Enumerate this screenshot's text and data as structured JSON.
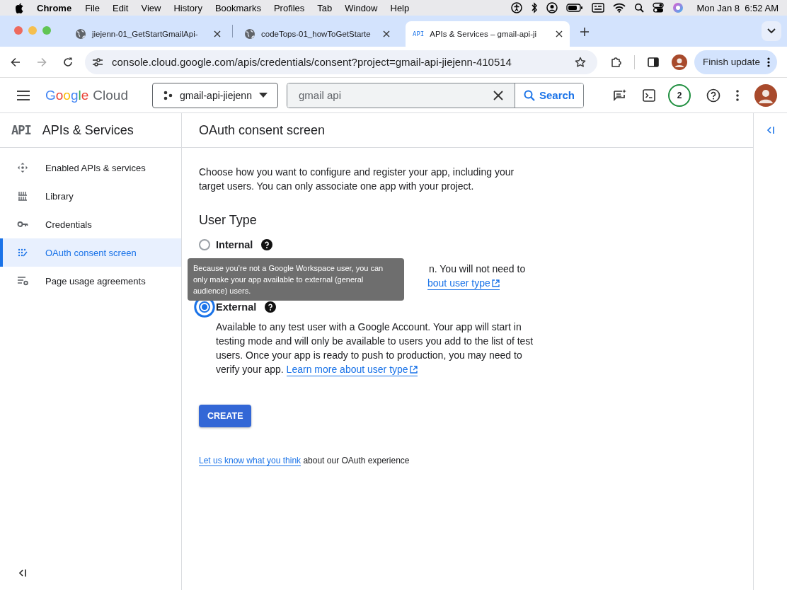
{
  "menu_bar": {
    "app": "Chrome",
    "items": [
      "File",
      "Edit",
      "View",
      "History",
      "Bookmarks",
      "Profiles",
      "Tab",
      "Window",
      "Help"
    ],
    "clock": "Mon Jan 8  6:52 AM"
  },
  "browser": {
    "tabs": [
      {
        "title": "jiejenn-01_GetStartGmailApi-",
        "selected": false
      },
      {
        "title": "codeTops-01_howToGetStarte",
        "selected": false
      },
      {
        "title": "APIs & Services – gmail-api-ji",
        "favicon_text": "API",
        "selected": true
      }
    ],
    "url": "console.cloud.google.com/apis/credentials/consent?project=gmail-api-jiejenn-410514",
    "update_button": "Finish update"
  },
  "console_header": {
    "brand": "Google",
    "product": "Cloud",
    "project": "gmail-api-jiejenn",
    "search": {
      "value": "gmail api"
    },
    "search_button": "Search",
    "notification_count": "2"
  },
  "sidebar": {
    "logo": "API",
    "title": "APIs & Services",
    "items": [
      {
        "label": "Enabled APIs & services",
        "selected": false
      },
      {
        "label": "Library",
        "selected": false
      },
      {
        "label": "Credentials",
        "selected": false
      },
      {
        "label": "OAuth consent screen",
        "selected": true
      },
      {
        "label": "Page usage agreements",
        "selected": false
      }
    ]
  },
  "page": {
    "title": "OAuth consent screen",
    "intro": "Choose how you want to configure and register your app, including your target users. You can only associate one app with your project.",
    "section_title": "User Type",
    "options": [
      {
        "label": "Internal",
        "selected": false,
        "covered": true,
        "description": "n. You will not need to",
        "link": "bout user type"
      },
      {
        "label": "External",
        "selected": true,
        "covered": false,
        "description": "Available to any test user with a Google Account. Your app will start in testing mode and will only be available to users you add to the list of test users. Once your app is ready to push to production, you may need to verify your app.",
        "link": "Learn more about user type"
      }
    ],
    "tooltip": "Because you’re not a Google Workspace user, you can only make your app available to external (general audience) users.",
    "create_button": "CREATE",
    "feedback": {
      "link": "Let us know what you think",
      "text": "about our OAuth experience"
    }
  }
}
